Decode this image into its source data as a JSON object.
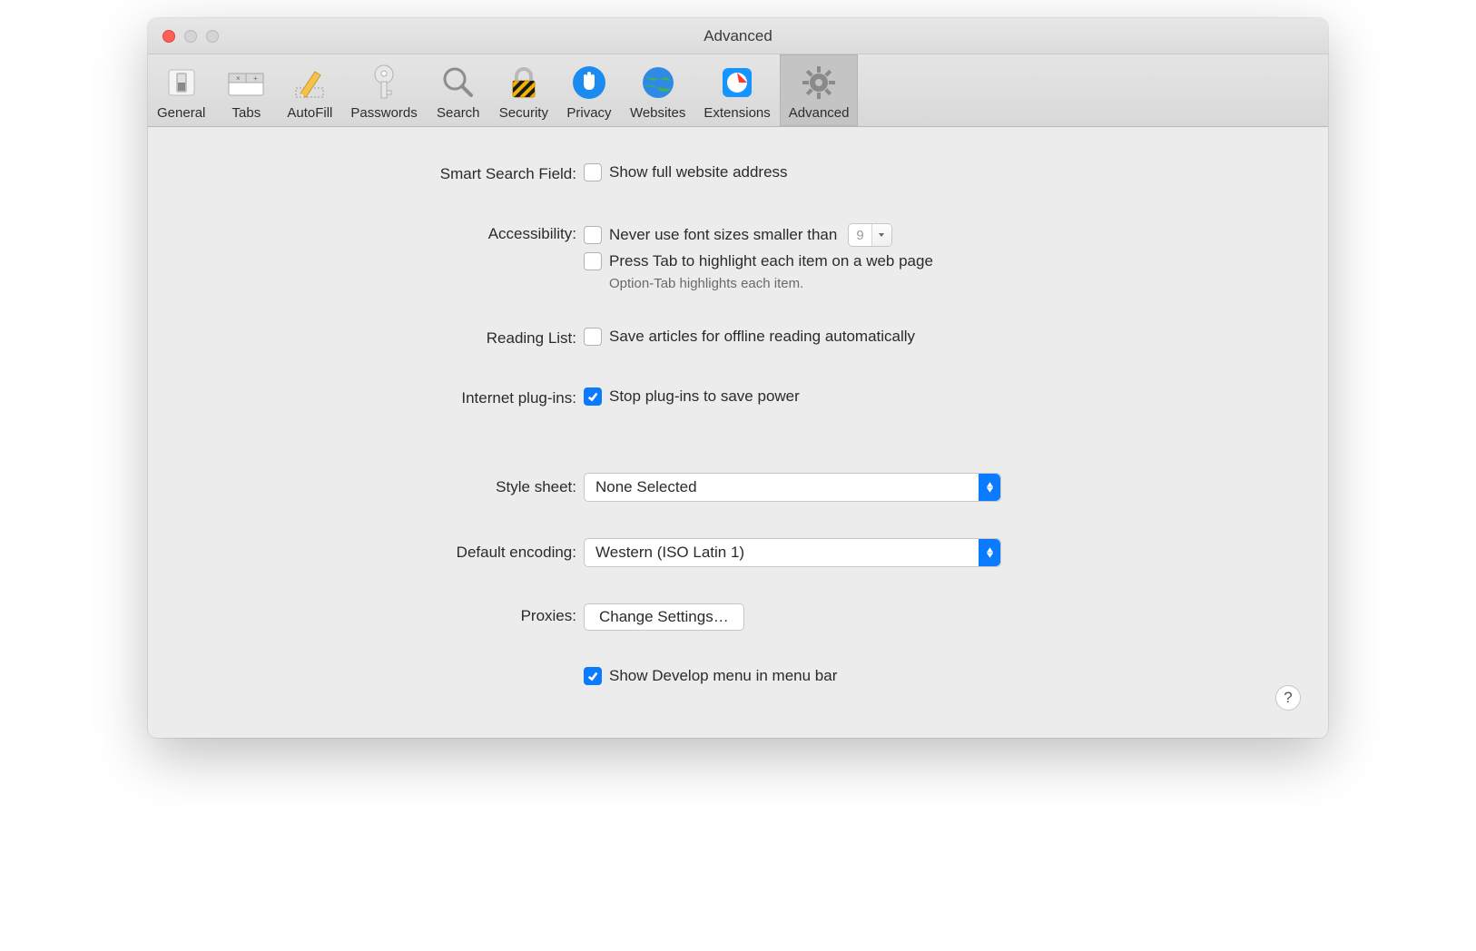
{
  "window": {
    "title": "Advanced"
  },
  "tabs": [
    {
      "label": "General"
    },
    {
      "label": "Tabs"
    },
    {
      "label": "AutoFill"
    },
    {
      "label": "Passwords"
    },
    {
      "label": "Search"
    },
    {
      "label": "Security"
    },
    {
      "label": "Privacy"
    },
    {
      "label": "Websites"
    },
    {
      "label": "Extensions"
    },
    {
      "label": "Advanced"
    }
  ],
  "form": {
    "smart_search_label": "Smart Search Field:",
    "smart_search_cb": "Show full website address",
    "accessibility_label": "Accessibility:",
    "accessibility_cb1": "Never use font sizes smaller than",
    "accessibility_font_size": "9",
    "accessibility_cb2": "Press Tab to highlight each item on a web page",
    "accessibility_hint": "Option-Tab highlights each item.",
    "reading_list_label": "Reading List:",
    "reading_list_cb": "Save articles for offline reading automatically",
    "plugins_label": "Internet plug-ins:",
    "plugins_cb": "Stop plug-ins to save power",
    "style_sheet_label": "Style sheet:",
    "style_sheet_value": "None Selected",
    "encoding_label": "Default encoding:",
    "encoding_value": "Western (ISO Latin 1)",
    "proxies_label": "Proxies:",
    "proxies_button": "Change Settings…",
    "develop_cb": "Show Develop menu in menu bar"
  },
  "help": "?"
}
